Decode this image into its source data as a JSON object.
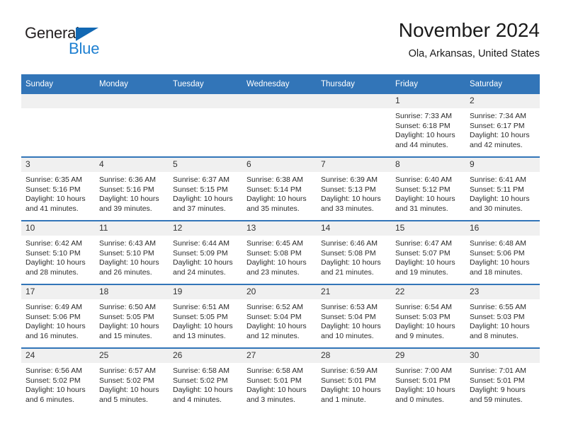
{
  "brand": {
    "name_part1": "General",
    "name_part2": "Blue",
    "triangle_icon": "triangle-icon",
    "color_dark": "#231f20",
    "color_blue": "#1d7fd1"
  },
  "header": {
    "title": "November 2024",
    "location": "Ola, Arkansas, United States"
  },
  "theme": {
    "header_bg": "#3275b8",
    "daynum_bg": "#f0f0f0",
    "row_border": "#3275b8"
  },
  "weekday_headers": [
    "Sunday",
    "Monday",
    "Tuesday",
    "Wednesday",
    "Thursday",
    "Friday",
    "Saturday"
  ],
  "weeks": [
    [
      {
        "day": "",
        "blank": true,
        "sunrise": "",
        "sunset": "",
        "daylight": ""
      },
      {
        "day": "",
        "blank": true,
        "sunrise": "",
        "sunset": "",
        "daylight": ""
      },
      {
        "day": "",
        "blank": true,
        "sunrise": "",
        "sunset": "",
        "daylight": ""
      },
      {
        "day": "",
        "blank": true,
        "sunrise": "",
        "sunset": "",
        "daylight": ""
      },
      {
        "day": "",
        "blank": true,
        "sunrise": "",
        "sunset": "",
        "daylight": ""
      },
      {
        "day": "1",
        "blank": false,
        "sunrise": "Sunrise: 7:33 AM",
        "sunset": "Sunset: 6:18 PM",
        "daylight": "Daylight: 10 hours and 44 minutes."
      },
      {
        "day": "2",
        "blank": false,
        "sunrise": "Sunrise: 7:34 AM",
        "sunset": "Sunset: 6:17 PM",
        "daylight": "Daylight: 10 hours and 42 minutes."
      }
    ],
    [
      {
        "day": "3",
        "blank": false,
        "sunrise": "Sunrise: 6:35 AM",
        "sunset": "Sunset: 5:16 PM",
        "daylight": "Daylight: 10 hours and 41 minutes."
      },
      {
        "day": "4",
        "blank": false,
        "sunrise": "Sunrise: 6:36 AM",
        "sunset": "Sunset: 5:16 PM",
        "daylight": "Daylight: 10 hours and 39 minutes."
      },
      {
        "day": "5",
        "blank": false,
        "sunrise": "Sunrise: 6:37 AM",
        "sunset": "Sunset: 5:15 PM",
        "daylight": "Daylight: 10 hours and 37 minutes."
      },
      {
        "day": "6",
        "blank": false,
        "sunrise": "Sunrise: 6:38 AM",
        "sunset": "Sunset: 5:14 PM",
        "daylight": "Daylight: 10 hours and 35 minutes."
      },
      {
        "day": "7",
        "blank": false,
        "sunrise": "Sunrise: 6:39 AM",
        "sunset": "Sunset: 5:13 PM",
        "daylight": "Daylight: 10 hours and 33 minutes."
      },
      {
        "day": "8",
        "blank": false,
        "sunrise": "Sunrise: 6:40 AM",
        "sunset": "Sunset: 5:12 PM",
        "daylight": "Daylight: 10 hours and 31 minutes."
      },
      {
        "day": "9",
        "blank": false,
        "sunrise": "Sunrise: 6:41 AM",
        "sunset": "Sunset: 5:11 PM",
        "daylight": "Daylight: 10 hours and 30 minutes."
      }
    ],
    [
      {
        "day": "10",
        "blank": false,
        "sunrise": "Sunrise: 6:42 AM",
        "sunset": "Sunset: 5:10 PM",
        "daylight": "Daylight: 10 hours and 28 minutes."
      },
      {
        "day": "11",
        "blank": false,
        "sunrise": "Sunrise: 6:43 AM",
        "sunset": "Sunset: 5:10 PM",
        "daylight": "Daylight: 10 hours and 26 minutes."
      },
      {
        "day": "12",
        "blank": false,
        "sunrise": "Sunrise: 6:44 AM",
        "sunset": "Sunset: 5:09 PM",
        "daylight": "Daylight: 10 hours and 24 minutes."
      },
      {
        "day": "13",
        "blank": false,
        "sunrise": "Sunrise: 6:45 AM",
        "sunset": "Sunset: 5:08 PM",
        "daylight": "Daylight: 10 hours and 23 minutes."
      },
      {
        "day": "14",
        "blank": false,
        "sunrise": "Sunrise: 6:46 AM",
        "sunset": "Sunset: 5:08 PM",
        "daylight": "Daylight: 10 hours and 21 minutes."
      },
      {
        "day": "15",
        "blank": false,
        "sunrise": "Sunrise: 6:47 AM",
        "sunset": "Sunset: 5:07 PM",
        "daylight": "Daylight: 10 hours and 19 minutes."
      },
      {
        "day": "16",
        "blank": false,
        "sunrise": "Sunrise: 6:48 AM",
        "sunset": "Sunset: 5:06 PM",
        "daylight": "Daylight: 10 hours and 18 minutes."
      }
    ],
    [
      {
        "day": "17",
        "blank": false,
        "sunrise": "Sunrise: 6:49 AM",
        "sunset": "Sunset: 5:06 PM",
        "daylight": "Daylight: 10 hours and 16 minutes."
      },
      {
        "day": "18",
        "blank": false,
        "sunrise": "Sunrise: 6:50 AM",
        "sunset": "Sunset: 5:05 PM",
        "daylight": "Daylight: 10 hours and 15 minutes."
      },
      {
        "day": "19",
        "blank": false,
        "sunrise": "Sunrise: 6:51 AM",
        "sunset": "Sunset: 5:05 PM",
        "daylight": "Daylight: 10 hours and 13 minutes."
      },
      {
        "day": "20",
        "blank": false,
        "sunrise": "Sunrise: 6:52 AM",
        "sunset": "Sunset: 5:04 PM",
        "daylight": "Daylight: 10 hours and 12 minutes."
      },
      {
        "day": "21",
        "blank": false,
        "sunrise": "Sunrise: 6:53 AM",
        "sunset": "Sunset: 5:04 PM",
        "daylight": "Daylight: 10 hours and 10 minutes."
      },
      {
        "day": "22",
        "blank": false,
        "sunrise": "Sunrise: 6:54 AM",
        "sunset": "Sunset: 5:03 PM",
        "daylight": "Daylight: 10 hours and 9 minutes."
      },
      {
        "day": "23",
        "blank": false,
        "sunrise": "Sunrise: 6:55 AM",
        "sunset": "Sunset: 5:03 PM",
        "daylight": "Daylight: 10 hours and 8 minutes."
      }
    ],
    [
      {
        "day": "24",
        "blank": false,
        "sunrise": "Sunrise: 6:56 AM",
        "sunset": "Sunset: 5:02 PM",
        "daylight": "Daylight: 10 hours and 6 minutes."
      },
      {
        "day": "25",
        "blank": false,
        "sunrise": "Sunrise: 6:57 AM",
        "sunset": "Sunset: 5:02 PM",
        "daylight": "Daylight: 10 hours and 5 minutes."
      },
      {
        "day": "26",
        "blank": false,
        "sunrise": "Sunrise: 6:58 AM",
        "sunset": "Sunset: 5:02 PM",
        "daylight": "Daylight: 10 hours and 4 minutes."
      },
      {
        "day": "27",
        "blank": false,
        "sunrise": "Sunrise: 6:58 AM",
        "sunset": "Sunset: 5:01 PM",
        "daylight": "Daylight: 10 hours and 3 minutes."
      },
      {
        "day": "28",
        "blank": false,
        "sunrise": "Sunrise: 6:59 AM",
        "sunset": "Sunset: 5:01 PM",
        "daylight": "Daylight: 10 hours and 1 minute."
      },
      {
        "day": "29",
        "blank": false,
        "sunrise": "Sunrise: 7:00 AM",
        "sunset": "Sunset: 5:01 PM",
        "daylight": "Daylight: 10 hours and 0 minutes."
      },
      {
        "day": "30",
        "blank": false,
        "sunrise": "Sunrise: 7:01 AM",
        "sunset": "Sunset: 5:01 PM",
        "daylight": "Daylight: 9 hours and 59 minutes."
      }
    ]
  ]
}
